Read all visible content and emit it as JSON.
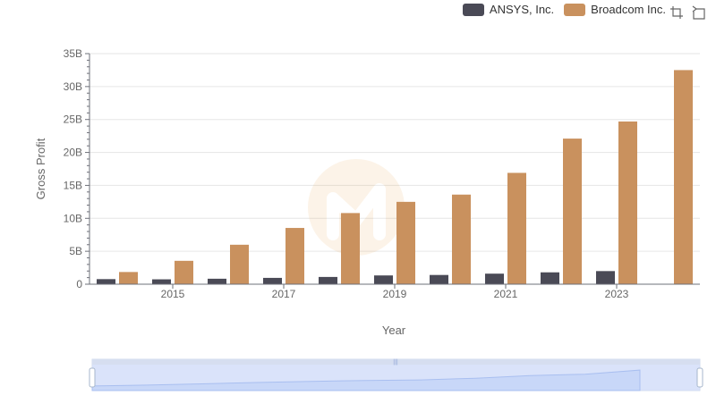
{
  "legend": [
    {
      "name": "ANSYS, Inc.",
      "color": "#4a4a56"
    },
    {
      "name": "Broadcom Inc.",
      "color": "#c9915e"
    }
  ],
  "toolbox": {
    "icons": [
      "zoom-icon",
      "restore-icon"
    ]
  },
  "chart_data": {
    "type": "bar",
    "xlabel": "Year",
    "ylabel": "Gross Profit",
    "categories": [
      "2014",
      "2015",
      "2016",
      "2017",
      "2018",
      "2019",
      "2020",
      "2021",
      "2022",
      "2023",
      "2024"
    ],
    "x_tick_labels": [
      "2015",
      "2017",
      "2019",
      "2021",
      "2023"
    ],
    "y_tick_labels": [
      "0",
      "5B",
      "10B",
      "15B",
      "20B",
      "25B",
      "30B",
      "35B"
    ],
    "ylim": [
      0,
      35
    ],
    "y_unit": "B",
    "grid": true,
    "legend_position": "top-right",
    "series": [
      {
        "name": "ANSYS, Inc.",
        "color": "#4a4a56",
        "values": [
          0.77,
          0.74,
          0.83,
          0.96,
          1.1,
          1.33,
          1.4,
          1.6,
          1.8,
          1.99,
          null
        ]
      },
      {
        "name": "Broadcom Inc.",
        "color": "#c9915e",
        "values": [
          1.85,
          3.55,
          5.99,
          8.54,
          10.8,
          12.5,
          13.6,
          16.9,
          22.1,
          24.7,
          32.5
        ]
      }
    ]
  },
  "data_zoom": {
    "start_percent": 0,
    "end_percent": 100
  }
}
